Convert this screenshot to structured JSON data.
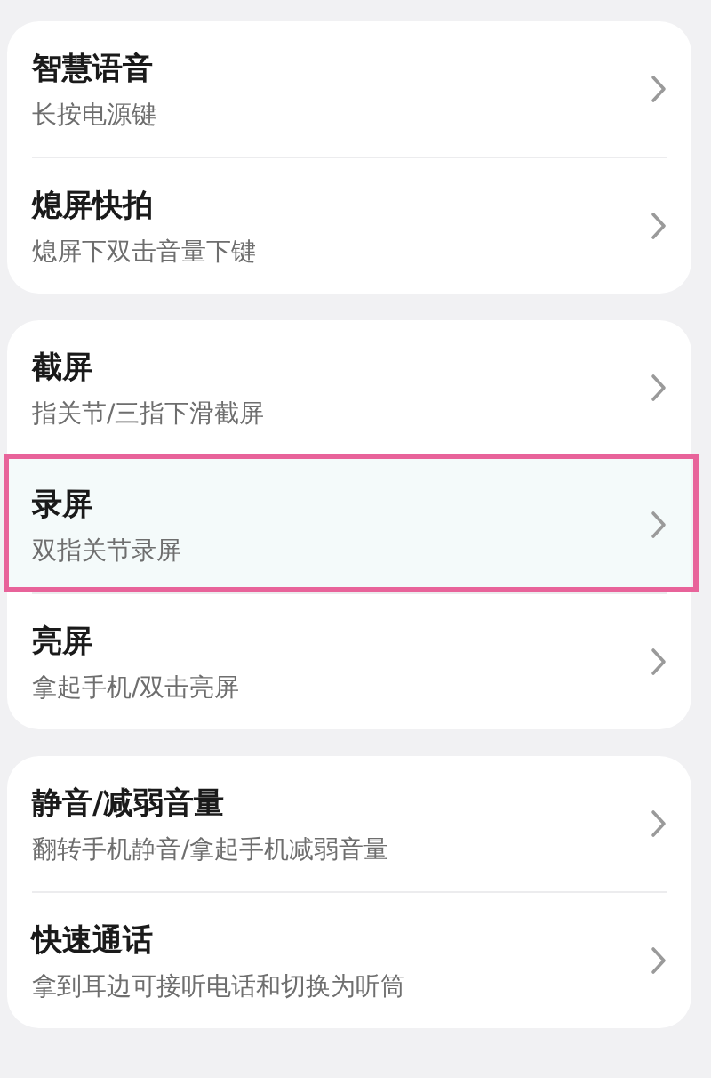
{
  "groups": [
    {
      "items": [
        {
          "title": "智慧语音",
          "subtitle": "长按电源键",
          "highlighted": false
        },
        {
          "title": "熄屏快拍",
          "subtitle": "熄屏下双击音量下键",
          "highlighted": false
        }
      ]
    },
    {
      "items": [
        {
          "title": "截屏",
          "subtitle": "指关节/三指下滑截屏",
          "highlighted": false
        },
        {
          "title": "录屏",
          "subtitle": "双指关节录屏",
          "highlighted": true
        },
        {
          "title": "亮屏",
          "subtitle": "拿起手机/双击亮屏",
          "highlighted": false
        }
      ]
    },
    {
      "items": [
        {
          "title": "静音/减弱音量",
          "subtitle": "翻转手机静音/拿起手机减弱音量",
          "highlighted": false
        },
        {
          "title": "快速通话",
          "subtitle": "拿到耳边可接听电话和切换为听筒",
          "highlighted": false
        }
      ]
    }
  ]
}
